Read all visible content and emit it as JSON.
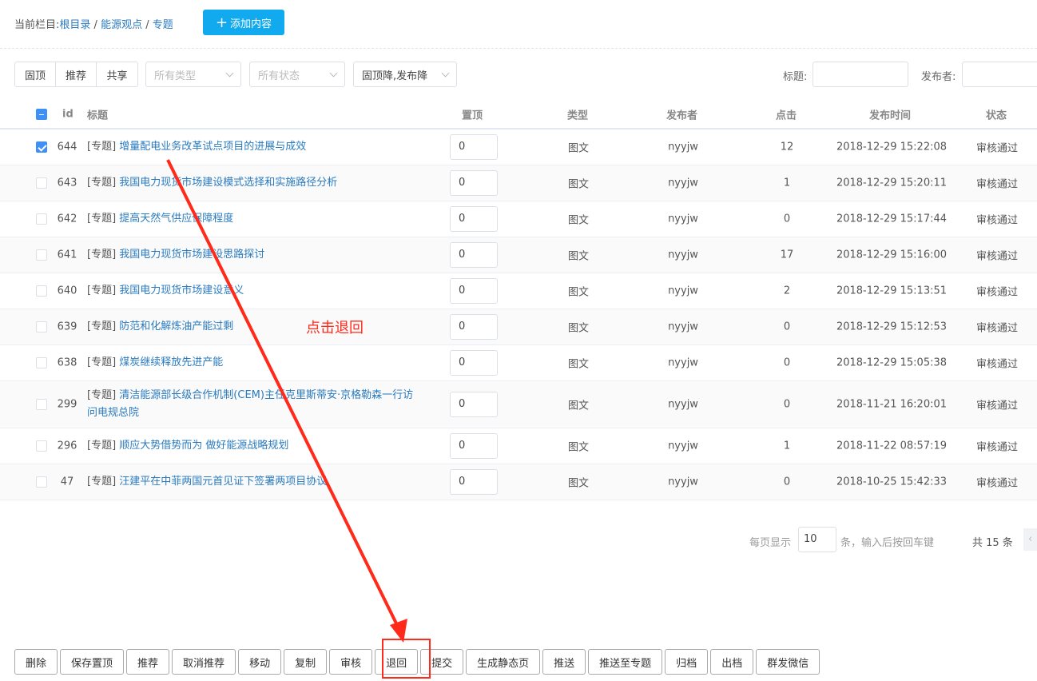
{
  "breadcrumb": {
    "prefix": "当前栏目:",
    "items": [
      "根目录",
      "能源观点",
      "专题"
    ],
    "sep": " / "
  },
  "add_button": {
    "icon": "plus-icon",
    "label": "添加内容"
  },
  "filters": {
    "segments": [
      "固顶",
      "推荐",
      "共享"
    ],
    "type_select": "所有类型",
    "status_select": "所有状态",
    "sort_select": "固顶降,发布降",
    "title_label": "标题:",
    "publisher_label": "发布者:"
  },
  "table": {
    "headers": {
      "id": "id",
      "title": "标题",
      "top": "置顶",
      "type": "类型",
      "publisher": "发布者",
      "clicks": "点击",
      "time": "发布时间",
      "status": "状态"
    },
    "rows": [
      {
        "checked": true,
        "id": "644",
        "tag": "[专题]",
        "title": "增量配电业务改革试点项目的进展与成效",
        "top": "0",
        "type": "图文",
        "publisher": "nyyjw",
        "clicks": "12",
        "time": "2018-12-29 15:22:08",
        "status": "审核通过"
      },
      {
        "checked": false,
        "id": "643",
        "tag": "[专题]",
        "title": "我国电力现货市场建设模式选择和实施路径分析",
        "top": "0",
        "type": "图文",
        "publisher": "nyyjw",
        "clicks": "1",
        "time": "2018-12-29 15:20:11",
        "status": "审核通过"
      },
      {
        "checked": false,
        "id": "642",
        "tag": "[专题]",
        "title": "提高天然气供应保障程度",
        "top": "0",
        "type": "图文",
        "publisher": "nyyjw",
        "clicks": "0",
        "time": "2018-12-29 15:17:44",
        "status": "审核通过"
      },
      {
        "checked": false,
        "id": "641",
        "tag": "[专题]",
        "title": "我国电力现货市场建设思路探讨",
        "top": "0",
        "type": "图文",
        "publisher": "nyyjw",
        "clicks": "17",
        "time": "2018-12-29 15:16:00",
        "status": "审核通过"
      },
      {
        "checked": false,
        "id": "640",
        "tag": "[专题]",
        "title": "我国电力现货市场建设意义",
        "top": "0",
        "type": "图文",
        "publisher": "nyyjw",
        "clicks": "2",
        "time": "2018-12-29 15:13:51",
        "status": "审核通过"
      },
      {
        "checked": false,
        "id": "639",
        "tag": "[专题]",
        "title": "防范和化解炼油产能过剩",
        "top": "0",
        "type": "图文",
        "publisher": "nyyjw",
        "clicks": "0",
        "time": "2018-12-29 15:12:53",
        "status": "审核通过"
      },
      {
        "checked": false,
        "id": "638",
        "tag": "[专题]",
        "title": "煤炭继续释放先进产能",
        "top": "0",
        "type": "图文",
        "publisher": "nyyjw",
        "clicks": "0",
        "time": "2018-12-29 15:05:38",
        "status": "审核通过"
      },
      {
        "checked": false,
        "id": "299",
        "tag": "[专题]",
        "title": "清洁能源部长级合作机制(CEM)主任克里斯蒂安·京格勒森一行访问电规总院",
        "top": "0",
        "type": "图文",
        "publisher": "nyyjw",
        "clicks": "0",
        "time": "2018-11-21 16:20:01",
        "status": "审核通过"
      },
      {
        "checked": false,
        "id": "296",
        "tag": "[专题]",
        "title": "顺应大势借势而为 做好能源战略规划",
        "top": "0",
        "type": "图文",
        "publisher": "nyyjw",
        "clicks": "1",
        "time": "2018-11-22 08:57:19",
        "status": "审核通过"
      },
      {
        "checked": false,
        "id": "47",
        "tag": "[专题]",
        "title": "汪建平在中菲两国元首见证下签署两项目协议",
        "top": "0",
        "type": "图文",
        "publisher": "nyyjw",
        "clicks": "0",
        "time": "2018-10-25 15:42:33",
        "status": "审核通过"
      }
    ]
  },
  "pagination": {
    "per_page_label": "每页显示",
    "per_page_value": "10",
    "hint": "条，输入后按回车键",
    "total": "共 15 条"
  },
  "actions": [
    "删除",
    "保存置顶",
    "推荐",
    "取消推荐",
    "移动",
    "复制",
    "审核",
    "退回",
    "提交",
    "生成静态页",
    "推送",
    "推送至专题",
    "归档",
    "出档",
    "群发微信"
  ],
  "annotation": {
    "text": "点击退回",
    "color": "#ff2a1a"
  }
}
